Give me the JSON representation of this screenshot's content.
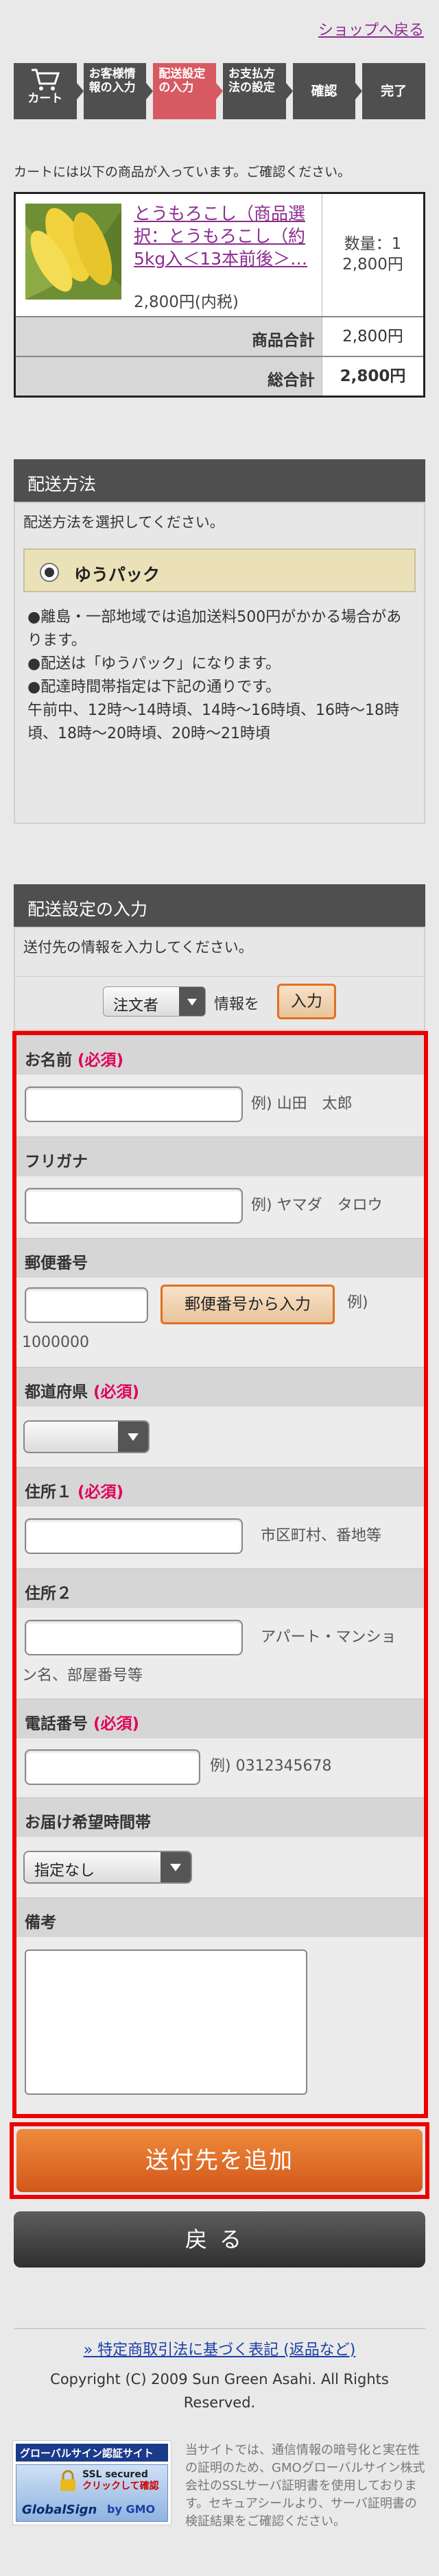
{
  "header": {
    "back_to_shop": "ショップへ戻る"
  },
  "steps": [
    {
      "label": "カート"
    },
    {
      "label": "お客様情報の入力"
    },
    {
      "label": "配送設定の入力"
    },
    {
      "label": "お支払方法の設定"
    },
    {
      "label": "確認"
    },
    {
      "label": "完了"
    }
  ],
  "cart": {
    "note": "カートには以下の商品が入っています。ご確認ください。",
    "item": {
      "name": "とうもろこし（商品選択：とうもろこし（約5kg入＜13本前後＞…",
      "price": "2,800円(内税)",
      "qty_label": "数量：1",
      "qty_price": "2,800円"
    },
    "subtotal_label": "商品合計",
    "subtotal": "2,800円",
    "total_label": "総合計",
    "total": "2,800円"
  },
  "shipping": {
    "title": "配送方法",
    "desc": "配送方法を選択してください。",
    "option": "ゆうパック",
    "notes": [
      "●離島・一部地域では追加送料500円がかかる場合があります。",
      "●配送は「ゆうパック」になります。",
      "●配達時間帯指定は下記の通りです。",
      "午前中、12時〜14時頃、14時〜16時頃、16時〜18時頃、18時〜20時頃、20時〜21時頃"
    ]
  },
  "delivery": {
    "title": "配送設定の入力",
    "desc": "送付先の情報を入力してください。",
    "orderer_select": "注文者",
    "info_wo": "情報を",
    "input_button": "入力"
  },
  "form": {
    "required": "(必須)",
    "name_label": "お名前",
    "name_hint": "例) 山田　太郎",
    "kana_label": "フリガナ",
    "kana_hint": "例) ヤマダ　タロウ",
    "zip_label": "郵便番号",
    "zip_button": "郵便番号から入力",
    "zip_hint_1": "例)",
    "zip_hint_2": "1000000",
    "pref_label": "都道府県",
    "addr1_label": "住所１",
    "addr1_hint": "市区町村、番地等",
    "addr2_label": "住所２",
    "addr2_hint_1": "アパート・マンショ",
    "addr2_hint_2": "ン名、部屋番号等",
    "tel_label": "電話番号",
    "tel_hint": "例) 0312345678",
    "time_label": "お届け希望時間帯",
    "time_value": "指定なし",
    "memo_label": "備考"
  },
  "actions": {
    "add": "送付先を追加",
    "back": "戻る"
  },
  "footer": {
    "law_link": "» 特定商取引法に基づく表記 (返品など)",
    "copyright": "Copyright (C) 2009 Sun Green Asahi. All Rights Reserved.",
    "seal_top": "グローバルサイン認証サイト",
    "seal_ssl_1": "SSL secured",
    "seal_ssl_2": "クリックして確認",
    "seal_brand": "GlobalSign",
    "seal_by": "by GMO",
    "seal_text": "当サイトでは、通信情報の暗号化と実在性の証明のため、GMOグローバルサイン株式会社のSSLサーバ証明書を使用しております。セキュアシールより、サーバ証明書の検証結果をご確認ください。"
  },
  "colors": {
    "accent": "#d75a63",
    "orange": "#e07020",
    "required": "#e0005a",
    "highlight_border": "#ef0000"
  }
}
